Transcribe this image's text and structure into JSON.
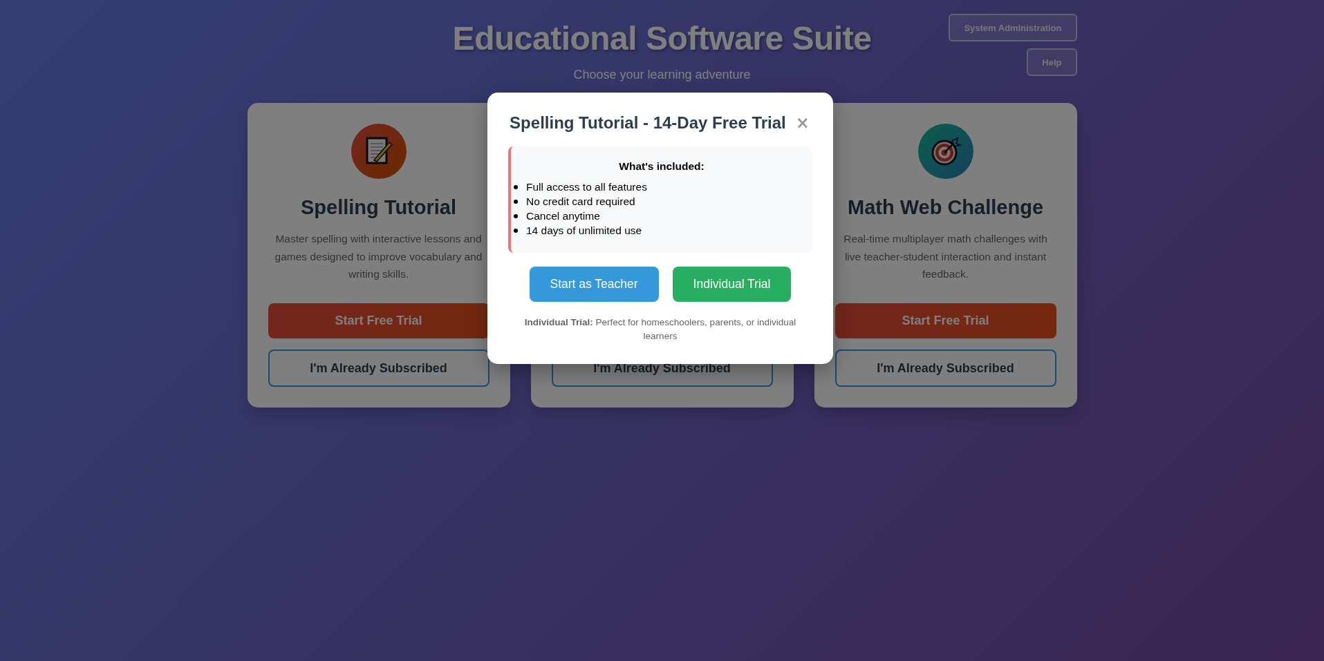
{
  "header": {
    "title": "Educational Software Suite",
    "subtitle": "Choose your learning adventure"
  },
  "top_buttons": [
    "System Administration",
    "Help"
  ],
  "cards": [
    {
      "icon": {
        "kind": "memo"
      },
      "title": "Spelling Tutorial",
      "description": "Master spelling with interactive lessons and games designed to improve vocabulary and writing skills.",
      "trial_button": "Start Free Trial",
      "subscribed_button": "I'm Already Subscribed"
    },
    {
      "subscribed_button": "I'm Already Subscribed"
    },
    {
      "icon": {
        "kind": "target"
      },
      "title": "Math Web Challenge",
      "description": "Real-time multiplayer math challenges with live teacher-student interaction and instant feedback.",
      "trial_button": "Start Free Trial",
      "subscribed_button": "I'm Already Subscribed"
    }
  ],
  "modal": {
    "title": "Spelling Tutorial - 14-Day Free Trial",
    "close": "×",
    "included_heading": "What's included:",
    "included": [
      "Full access to all features",
      "No credit card required",
      "Cancel anytime",
      "14 days of unlimited use"
    ],
    "buttons": [
      {
        "label": "Start as Teacher",
        "kind": "teacher"
      },
      {
        "label": "Individual Trial",
        "kind": "individual"
      }
    ],
    "note": "**Individual Trial:** Perfect for homeschoolers, parents, or individual learners"
  }
}
